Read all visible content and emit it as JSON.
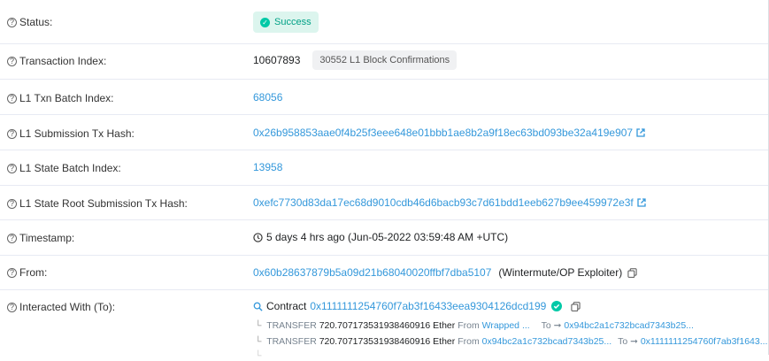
{
  "rows": {
    "status": {
      "label": "Status:",
      "badge": "Success"
    },
    "tx_index": {
      "label": "Transaction Index:",
      "value": "10607893",
      "confirmations": "30552 L1 Block Confirmations"
    },
    "l1_txn_batch": {
      "label": "L1 Txn Batch Index:",
      "value": "68056"
    },
    "l1_submission": {
      "label": "L1 Submission Tx Hash:",
      "value": "0x26b958853aae0f4b25f3eee648e01bbb1ae8b2a9f18ec63bd093be32a419e907"
    },
    "l1_state_batch": {
      "label": "L1 State Batch Index:",
      "value": "13958"
    },
    "l1_state_root": {
      "label": "L1 State Root Submission Tx Hash:",
      "value": "0xefc7730d83da17ec68d9010cdb46d6bacb93c7d61bdd1eeb627b9ee459972e3f"
    },
    "timestamp": {
      "label": "Timestamp:",
      "value": "5 days 4 hrs ago (Jun-05-2022 03:59:48 AM +UTC)"
    },
    "from": {
      "label": "From:",
      "address": "0x60b28637879b5a09d21b68040020ffbf7dba5107",
      "tag": "(Wintermute/OP Exploiter)"
    },
    "interacted": {
      "label": "Interacted With (To):",
      "contract_prefix": "Contract",
      "contract_address": "0x1111111254760f7ab3f16433eea9304126dcd199",
      "transfers": [
        {
          "kw": "TRANSFER",
          "amount": "720.707173531938460916 Ether",
          "from_kw": "From",
          "from": "Wrapped ...",
          "to_kw": "To",
          "to": "0x94bc2a1c732bcad7343b25..."
        },
        {
          "kw": "TRANSFER",
          "amount": "720.707173531938460916 Ether",
          "from_kw": "From",
          "from": "0x94bc2a1c732bcad7343b25...",
          "to_kw": "To",
          "to": "0x1111111254760f7ab3f1643..."
        }
      ]
    }
  },
  "colors": {
    "link": "#3498db",
    "success_bg": "#dcf5ee",
    "success_text": "#00a186",
    "border": "#e7eaf3"
  },
  "icons": [
    "question-circle-icon",
    "check-circle-icon",
    "external-link-icon",
    "copy-icon",
    "clock-icon",
    "search-contract-icon",
    "verified-check-icon",
    "arrow-right-icon"
  ]
}
